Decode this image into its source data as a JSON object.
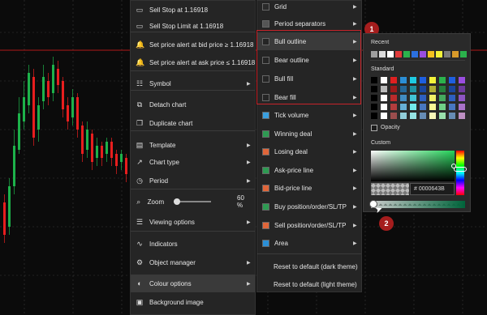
{
  "main_menu": {
    "items": [
      {
        "label": "Sell Stop at 1.16918",
        "icon": "sell-stop-icon",
        "glyph": "▭",
        "arrow": false
      },
      {
        "label": "Sell Stop Limit at 1.16918",
        "icon": "sell-stop-limit-icon",
        "glyph": "▭",
        "arrow": false
      },
      {
        "label": "Set price alert at bid price ≥ 1.16918",
        "icon": "bell-icon",
        "glyph": "🔔",
        "arrow": false
      },
      {
        "label": "Set price alert at ask price ≤ 1.16918",
        "icon": "bell-icon",
        "glyph": "🔔",
        "arrow": false
      },
      {
        "label": "Symbol",
        "icon": "symbol-icon",
        "glyph": "☷",
        "arrow": true
      },
      {
        "label": "Detach chart",
        "icon": "detach-icon",
        "glyph": "⧉",
        "arrow": false
      },
      {
        "label": "Duplicate chart",
        "icon": "duplicate-icon",
        "glyph": "❐",
        "arrow": false
      },
      {
        "label": "Template",
        "icon": "template-icon",
        "glyph": "▤",
        "arrow": true
      },
      {
        "label": "Chart type",
        "icon": "chart-type-icon",
        "glyph": "↗",
        "arrow": true
      },
      {
        "label": "Period",
        "icon": "period-icon",
        "glyph": "◷",
        "arrow": true
      },
      {
        "label": "Zoom",
        "icon": "zoom-icon",
        "glyph": "⌕",
        "arrow": false,
        "value": "60 %"
      },
      {
        "label": "Viewing options",
        "icon": "viewing-options-icon",
        "glyph": "☰",
        "arrow": true
      },
      {
        "label": "Indicators",
        "icon": "indicators-icon",
        "glyph": "∿",
        "arrow": false
      },
      {
        "label": "Object manager",
        "icon": "object-manager-icon",
        "glyph": "⚙",
        "arrow": true
      },
      {
        "label": "Colour options",
        "icon": "colour-options-icon",
        "glyph": "◐",
        "arrow": true
      },
      {
        "label": "Background image",
        "icon": "background-image-icon",
        "glyph": "▣",
        "arrow": false
      }
    ]
  },
  "color_menu": {
    "items": [
      {
        "label": "Grid",
        "color": "#2a2a2a"
      },
      {
        "label": "Period separators",
        "color": "#555555"
      },
      {
        "label": "Bull outline",
        "color": "#252525"
      },
      {
        "label": "Bear outline",
        "color": "#252525"
      },
      {
        "label": "Bull fill",
        "color": "#252525"
      },
      {
        "label": "Bear fill",
        "color": "#252525"
      },
      {
        "label": "Tick volume",
        "color": "#3aa0e0"
      },
      {
        "label": "Winning deal",
        "color": "#2e9a52"
      },
      {
        "label": "Losing deal",
        "color": "#e0663a"
      },
      {
        "label": "Ask-price line",
        "color": "#2e9a52"
      },
      {
        "label": "Bid-price line",
        "color": "#e0663a"
      },
      {
        "label": "Buy position/order/SL/TP",
        "color": "#2e9a52"
      },
      {
        "label": "Sell position/order/SL/TP",
        "color": "#e0663a"
      },
      {
        "label": "Area",
        "color": "#2b8fd6"
      }
    ],
    "reset_dark": "Reset to default (dark theme)",
    "reset_light": "Reset to default (light theme)"
  },
  "annotations": {
    "badge1": "1",
    "badge2": "2"
  },
  "picker": {
    "recent_label": "Recent",
    "standard_label": "Standard",
    "opacity_label": "Opacity",
    "custom_label": "Custom",
    "hex_value": "# 0000643B",
    "recent_colors": [
      "#9e9e9e",
      "#dcdcdc",
      "#ffffff",
      "#e03a3a",
      "#2bb24c",
      "#2b6fe0",
      "#9a4de0",
      "#f4c21f",
      "#f2f23a",
      "#7a7a7a",
      "#d99a2a",
      "#2bb24c"
    ],
    "standard_top": [
      "#000000",
      "#ffffff",
      "#e02020",
      "#2b8fd6",
      "#1ecbe1",
      "#1e5fe0",
      "#f2f23a",
      "#2bb24c",
      "#1e5fe0",
      "#9a4de0"
    ]
  },
  "chart_colors": {
    "bull": "#1db24a",
    "bear": "#e81e1e",
    "price_line": "#e81e1e",
    "grid": "#3a3a3a"
  }
}
